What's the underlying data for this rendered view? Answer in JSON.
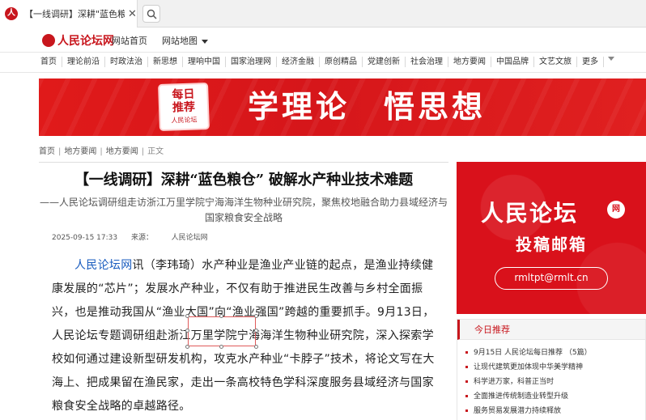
{
  "browser": {
    "tab_title": "【一线调研】深耕\"蓝色粮仓\"",
    "close_glyph": "✕",
    "favicon_glyph": "人"
  },
  "site": {
    "logo_text": "人民论坛网",
    "home_link": "网站首页",
    "map_link": "网站地图"
  },
  "nav": [
    "首页",
    "理论前沿",
    "时政法治",
    "新思想",
    "理响中国",
    "国家治理网",
    "经济金融",
    "原创精品",
    "党建创新",
    "社会治理",
    "地方要闻",
    "中国品牌",
    "文艺文旅",
    "更多"
  ],
  "banner": {
    "badge_line1": "每日",
    "badge_line2": "推荐",
    "badge_line3": "人民论坛",
    "slogan": "学理论　悟思想"
  },
  "breadcrumb": {
    "items": [
      "首页",
      "地方要闻",
      "地方要闻"
    ],
    "separator": "|",
    "current": "正文"
  },
  "article": {
    "title": "【一线调研】深耕“蓝色粮仓” 破解水产种业技术难题",
    "subtitle": "——人民论坛调研组走访浙江万里学院宁海海洋生物种业研究院，聚焦校地融合助力县域经济与国家粮食安全战略",
    "date": "2025-09-15 17:33",
    "source_label": "来源：",
    "source_name": "人民论坛网",
    "body_source": "人民论坛网",
    "body_text": "讯（李玮琦）水产种业是渔业产业链的起点，是渔业持续健康发展的“芯片”；发展水产种业，不仅有助于推进民生改善与乡村全面振兴，也是推动我国从“渔业大国”向“渔业强国”跨越的重要抓手。9月13日，人民论坛专题调研组赴浙江万里学院宁海海洋生物种业研究院，深入探索学校如何通过建设新型研发机构，攻克水产种业“卡脖子”技术，将论文写在大海上、把成果留在渔民家，走出一条高校特色学科深度服务县域经济与国家粮食安全战略的卓越路径。"
  },
  "ad": {
    "brand": "人民论坛",
    "brand_badge": "网",
    "caption": "投稿邮箱",
    "email": "rmltpt@rmlt.cn"
  },
  "recommend": {
    "title": "今日推荐",
    "items": [
      "9月15日 人民论坛每日推荐 （5篇）",
      "让现代建筑更加体现中华美学精神",
      "科学进万家，科普正当时",
      "全面推进传统制造业转型升级",
      "服务贸易发展潜力持续释放"
    ]
  },
  "colors": {
    "brand_red": "#c8161d",
    "link_blue": "#1a5dbf",
    "selection_border": "#e05a5a"
  }
}
